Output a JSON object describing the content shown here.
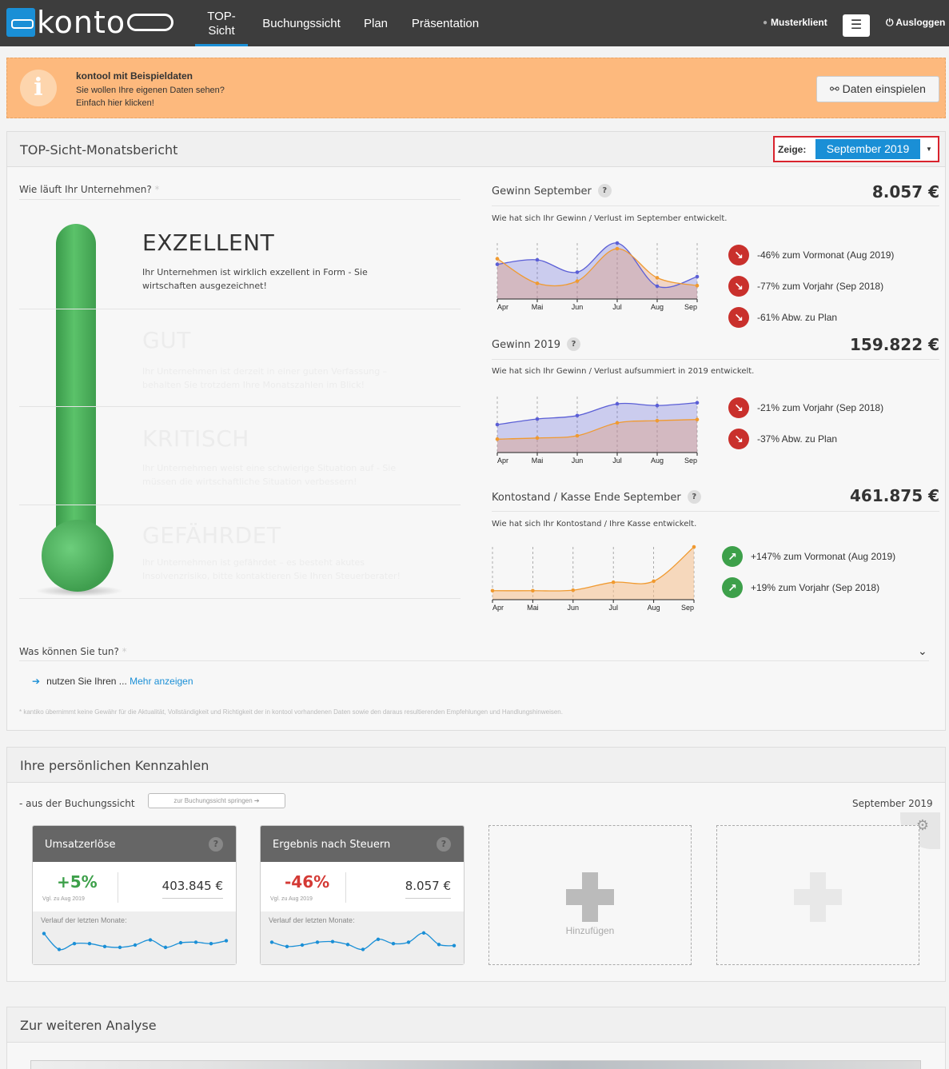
{
  "nav": {
    "logo_text": "konto",
    "top_sicht_line1": "TOP-",
    "top_sicht_line2": "Sicht",
    "buchungssicht": "Buchungssicht",
    "plan": "Plan",
    "praesentation": "Präsentation",
    "user": "Musterklient",
    "menu_icon": "☰",
    "logout": "Ausloggen"
  },
  "banner": {
    "title": "kontool mit Beispieldaten",
    "line1": "Sie wollen Ihre eigenen Daten sehen?",
    "line2": "Einfach hier klicken!",
    "button": "Daten einspielen",
    "icon": "i"
  },
  "report": {
    "title": "TOP-Sicht-Monatsbericht",
    "zeige_label": "Zeige:",
    "zeige_value": "September 2019",
    "question": "Wie läuft Ihr Unternehmen?",
    "levels": [
      {
        "title": "EXZELLENT",
        "text": "Ihr Unternehmen ist wirklich exzellent in Form - Sie wirtschaften ausgezeichnet!"
      },
      {
        "title": "GUT",
        "text": "Ihr Unternehmen ist derzeit in einer guten Verfassung – behalten Sie trotzdem Ihre Monatszahlen im Blick!"
      },
      {
        "title": "KRITISCH",
        "text": "Ihr Unternehmen weist eine schwierige Situation auf - Sie müssen die wirtschaftliche Situation verbessern!"
      },
      {
        "title": "GEFÄHRDET",
        "text": "Ihr Unternehmen ist gefährdet – es besteht akutes Insolvenzrisiko, bitte kontaktieren Sie Ihren Steuerberater!"
      }
    ],
    "metrics": [
      {
        "title": "Gewinn September",
        "value": "8.057 €",
        "subtitle": "Wie hat sich Ihr Gewinn / Verlust im September entwickelt.",
        "stats": [
          {
            "dir": "down",
            "text": "-46% zum Vormonat (Aug 2019)"
          },
          {
            "dir": "down",
            "text": "-77% zum Vorjahr (Sep 2018)"
          },
          {
            "dir": "down",
            "text": "-61% Abw. zu Plan"
          }
        ]
      },
      {
        "title": "Gewinn 2019",
        "value": "159.822 €",
        "subtitle": "Wie hat sich Ihr Gewinn / Verlust aufsummiert in 2019 entwickelt.",
        "stats": [
          {
            "dir": "down",
            "text": "-21% zum Vorjahr (Sep 2018)"
          },
          {
            "dir": "down",
            "text": "-37% Abw. zu Plan"
          }
        ]
      },
      {
        "title": "Kontostand / Kasse Ende September",
        "value": "461.875 €",
        "subtitle": "Wie hat sich Ihr Kontostand / Ihre Kasse entwickelt.",
        "stats": [
          {
            "dir": "up",
            "text": "+147% zum Vormonat (Aug 2019)"
          },
          {
            "dir": "up",
            "text": "+19% zum Vorjahr (Sep 2018)"
          }
        ]
      }
    ],
    "months": [
      "Apr",
      "Mai",
      "Jun",
      "Jul",
      "Aug",
      "Sep"
    ],
    "colors": {
      "blue": "#5b5fd6",
      "orange": "#f09a30",
      "green": "#3da04a",
      "red": "#c9302c"
    },
    "was_tun": "Was können Sie tun?",
    "tun_text": "nutzen Sie Ihren ... ",
    "tun_link": "Mehr anzeigen",
    "disclaimer": "* kantiko übernimmt keine Gewähr für die Aktualität, Vollständigkeit und Richtigkeit der in kontool vorhandenen Daten sowie den daraus resultierenden Empfehlungen und Handlungshinweisen."
  },
  "chart_data": [
    {
      "type": "line",
      "x": [
        "Apr",
        "Mai",
        "Jun",
        "Jul",
        "Aug",
        "Sep"
      ],
      "series": [
        {
          "values": [
            0.62,
            0.7,
            0.48,
            1.0,
            0.23,
            0.4
          ]
        },
        {
          "values": [
            0.72,
            0.28,
            0.32,
            0.9,
            0.38,
            0.24
          ]
        }
      ]
    },
    {
      "type": "line",
      "x": [
        "Apr",
        "Mai",
        "Jun",
        "Jul",
        "Aug",
        "Sep"
      ],
      "series": [
        {
          "values": [
            0.5,
            0.6,
            0.66,
            0.87,
            0.84,
            0.89
          ]
        },
        {
          "values": [
            0.24,
            0.26,
            0.3,
            0.53,
            0.57,
            0.59
          ]
        }
      ]
    },
    {
      "type": "line",
      "x": [
        "Apr",
        "Mai",
        "Jun",
        "Jul",
        "Aug",
        "Sep"
      ],
      "series": [
        {
          "values": [
            0.17,
            0.17,
            0.18,
            0.33,
            0.35,
            1.0
          ]
        }
      ]
    }
  ],
  "kennzahlen": {
    "title": "Ihre persönlichen Kennzahlen",
    "sub": "- aus der Buchungssicht",
    "jump": "zur Buchungssicht springen ➔",
    "month": "September 2019",
    "verlauf": "Verlauf der letzten Monate:",
    "add_label": "Hinzufügen",
    "cards": [
      {
        "title": "Umsatzerlöse",
        "pct": "+5%",
        "vgl": "Vgl. zu Aug 2019",
        "value": "403.845 €",
        "spark": [
          0.9,
          0.35,
          0.55,
          0.55,
          0.45,
          0.42,
          0.5,
          0.68,
          0.42,
          0.58,
          0.6,
          0.55,
          0.65
        ]
      },
      {
        "title": "Ergebnis nach Steuern",
        "pct": "-46%",
        "vgl": "Vgl. zu Aug 2019",
        "value": "8.057 €",
        "spark": [
          0.6,
          0.45,
          0.5,
          0.6,
          0.62,
          0.52,
          0.35,
          0.7,
          0.55,
          0.6,
          0.92,
          0.52,
          0.48
        ]
      }
    ]
  },
  "analyse": {
    "title": "Zur weiteren Analyse"
  }
}
